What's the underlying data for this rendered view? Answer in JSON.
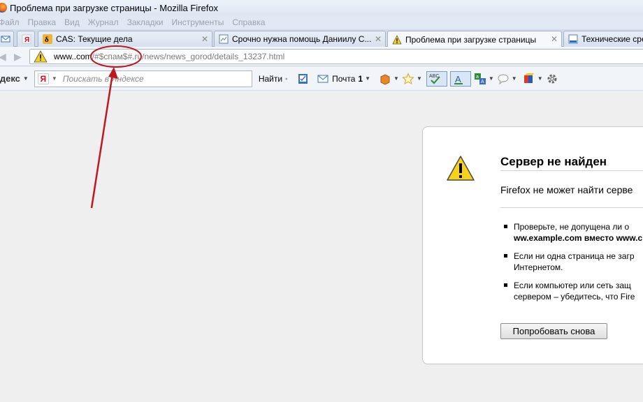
{
  "window": {
    "title": "Проблема при загрузке страницы - Mozilla Firefox"
  },
  "menu": [
    "Файл",
    "Правка",
    "Вид",
    "Журнал",
    "Закладки",
    "Инструменты",
    "Справка"
  ],
  "tabs": [
    {
      "label": "",
      "icon": "mail-icon"
    },
    {
      "label": "",
      "icon": "yandex-icon"
    },
    {
      "label": "CAS: Текущие дела",
      "icon": "cas-icon"
    },
    {
      "label": "Срочно нужна помощь Даниилу С...",
      "icon": "page-icon"
    },
    {
      "label": "Проблема при загрузке страницы",
      "icon": "warning-icon",
      "active": true
    },
    {
      "label": "Технические сре",
      "icon": "page-icon"
    }
  ],
  "url": {
    "host": "www..com",
    "path": "/#$спам$#.ru/news/news_gorod/details_13237.html"
  },
  "yandex": {
    "brand": "ндекс",
    "search_placeholder": "Поискать в Яндексе",
    "find_label": "Найти",
    "mail_label": "Почта",
    "mail_count": "1"
  },
  "error": {
    "title": "Сервер не найден",
    "short_desc": "Firefox не может найти серве",
    "tips": [
      {
        "lines": [
          "Проверьте, не допущена ли о",
          "ww.example.com вместо www.c"
        ]
      },
      {
        "lines": [
          "Если ни одна страница не загр",
          "Интернетом."
        ]
      },
      {
        "lines": [
          "Если компьютер или сеть защ",
          "сервером – убедитесь, что Fire"
        ]
      }
    ],
    "retry_label": "Попробовать снова"
  },
  "colors": {
    "annotation": "#c0161e",
    "accent": "#3a6fc4"
  }
}
